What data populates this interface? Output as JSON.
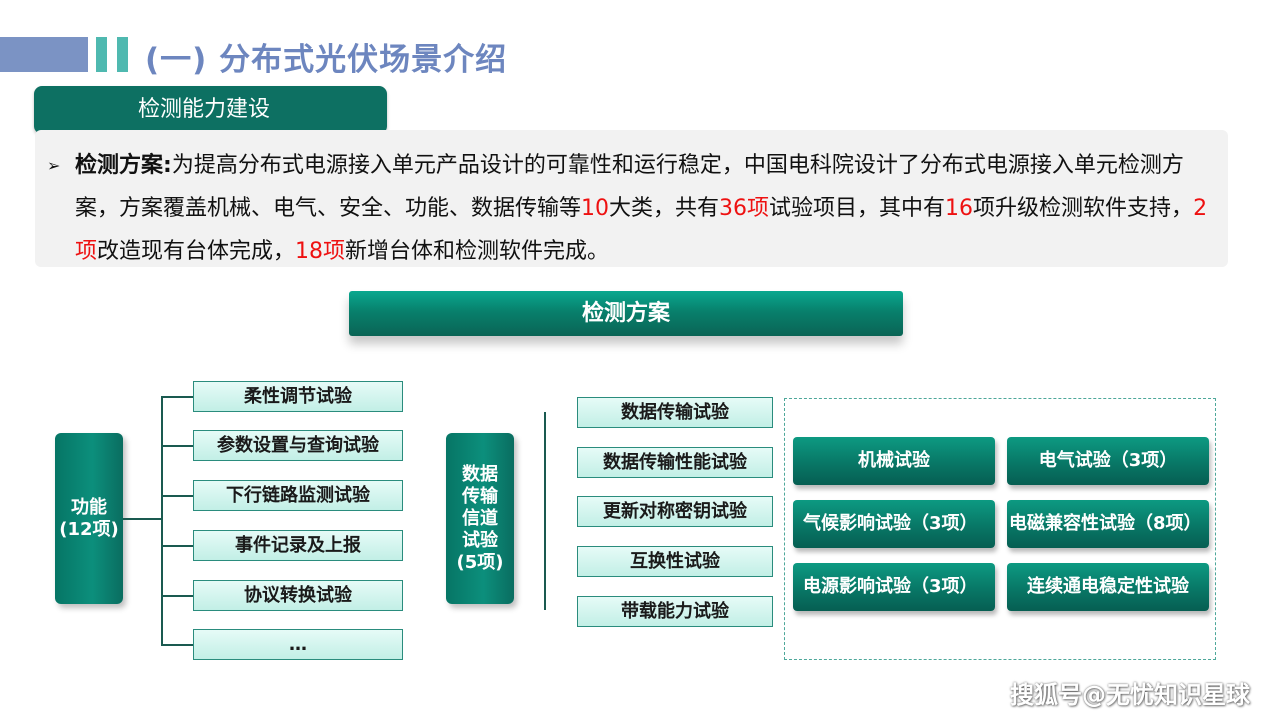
{
  "header": {
    "title": "(一) 分布式光伏场景介绍"
  },
  "section_tag": "检测能力建设",
  "description": {
    "bullet_label": "检测方案:",
    "part1": "为提高分布式电源接入单元产品设计的可靠性和运行稳定，中国电科院设计了分布式电源接入单元检测方案，方案覆盖机械、电气、安全、功能、数据传输等",
    "num_categories": "10",
    "part2": "大类，共有",
    "num_items": "36项",
    "part3": "试验项目，其中有",
    "num_software": "16",
    "part4": "项升级检测软件支持，",
    "num_modified": "2项",
    "part5": "改造现有台体完成，",
    "num_new": "18项",
    "part6": "新增台体和检测软件完成。"
  },
  "diagram": {
    "title": "检测方案",
    "function_group": {
      "label_line1": "功能",
      "label_line2": "(12项)",
      "items": [
        "柔性调节试验",
        "参数设置与查询试验",
        "下行链路监测试验",
        "事件记录及上报",
        "协议转换试验",
        "…"
      ]
    },
    "data_group": {
      "label_lines": [
        "数据",
        "传输",
        "信道",
        "试验",
        "(5项)"
      ],
      "items": [
        "数据传输试验",
        "数据传输性能试验",
        "更新对称密钥试验",
        "互换性试验",
        "带载能力试验"
      ]
    },
    "other_tests": [
      "机械试验",
      "电气试验（3项）",
      "气候影响试验（3项）",
      "电磁兼容性试验（8项）",
      "电源影响试验（3项）",
      "连续通电稳定性试验"
    ]
  },
  "watermark": "搜狐号@无忧知识星球",
  "colors": {
    "header_title": "#6d86bf",
    "header_bar": "#7b93c4",
    "accent_teal": "#4fb9b0",
    "dark_teal": "#0d7062",
    "highlight_red": "#ee1111"
  }
}
